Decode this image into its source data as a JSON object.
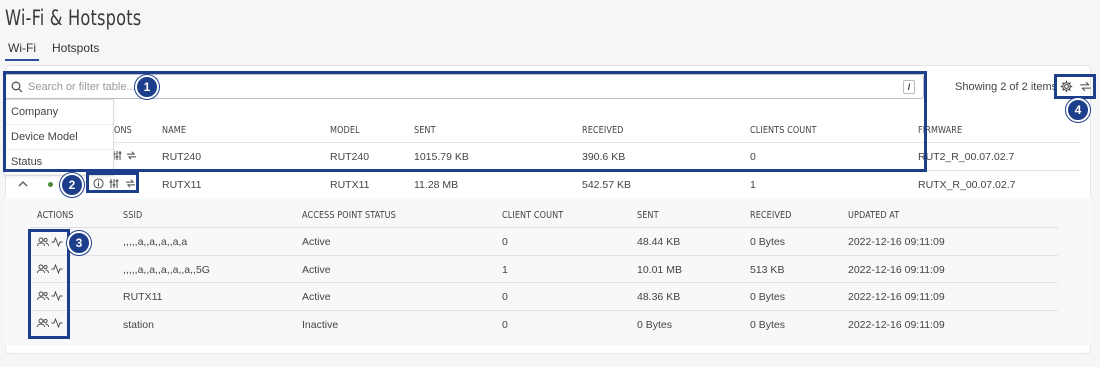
{
  "page": {
    "title": "Wi-Fi & Hotspots"
  },
  "tabs": [
    {
      "label": "Wi-Fi",
      "active": true
    },
    {
      "label": "Hotspots",
      "active": false
    }
  ],
  "search": {
    "placeholder": "Search or filter table...",
    "shortcut": "/"
  },
  "filter_dropdown": {
    "items": [
      "Company",
      "Device Model",
      "Status"
    ]
  },
  "toolbar": {
    "showing_text": "Showing 2 of 2 items",
    "settings_icon": "gear-icon",
    "refresh_icon": "refresh-icon"
  },
  "main_table": {
    "headers": {
      "actions": "ONS",
      "name": "NAME",
      "model": "MODEL",
      "sent": "SENT",
      "received": "RECEIVED",
      "clients_count": "CLIENTS COUNT",
      "firmware": "FIRMWARE"
    },
    "rows": [
      {
        "name": "RUT240",
        "model": "RUT240",
        "sent": "1015.79 KB",
        "received": "390.6 KB",
        "clients_count": "0",
        "firmware": "RUT2_R_00.07.02.7"
      },
      {
        "name": "RUTX11",
        "model": "RUTX11",
        "sent": "11.28 MB",
        "received": "542.57 KB",
        "clients_count": "1",
        "firmware": "RUTX_R_00.07.02.7",
        "status": "online"
      }
    ]
  },
  "ssid_table": {
    "headers": {
      "actions": "ACTIONS",
      "ssid": "SSID",
      "ap_status": "ACCESS POINT STATUS",
      "client_count": "CLIENT COUNT",
      "sent": "SENT",
      "received": "RECEIVED",
      "updated_at": "UPDATED AT"
    },
    "rows": [
      {
        "ssid": ",,,,,a,,a,,a,,a,a",
        "ap_status": "Active",
        "client_count": "0",
        "sent": "48.44 KB",
        "received": "0 Bytes",
        "updated_at": "2022-12-16 09:11:09"
      },
      {
        "ssid": ",,,,,a,,a,,a,,a,,a,,5G",
        "ap_status": "Active",
        "client_count": "1",
        "sent": "10.01 MB",
        "received": "513 KB",
        "updated_at": "2022-12-16 09:11:09"
      },
      {
        "ssid": "RUTX11",
        "ap_status": "Active",
        "client_count": "0",
        "sent": "48.36 KB",
        "received": "0 Bytes",
        "updated_at": "2022-12-16 09:11:09"
      },
      {
        "ssid": "station",
        "ap_status": "Inactive",
        "client_count": "0",
        "sent": "0 Bytes",
        "received": "0 Bytes",
        "updated_at": "2022-12-16 09:11:09"
      }
    ]
  },
  "annotations": [
    "1",
    "2",
    "3",
    "4"
  ],
  "colors": {
    "accent": "#1d3e8a",
    "tab_underline": "#2d4fa0",
    "status_online": "#4a8a3a"
  }
}
